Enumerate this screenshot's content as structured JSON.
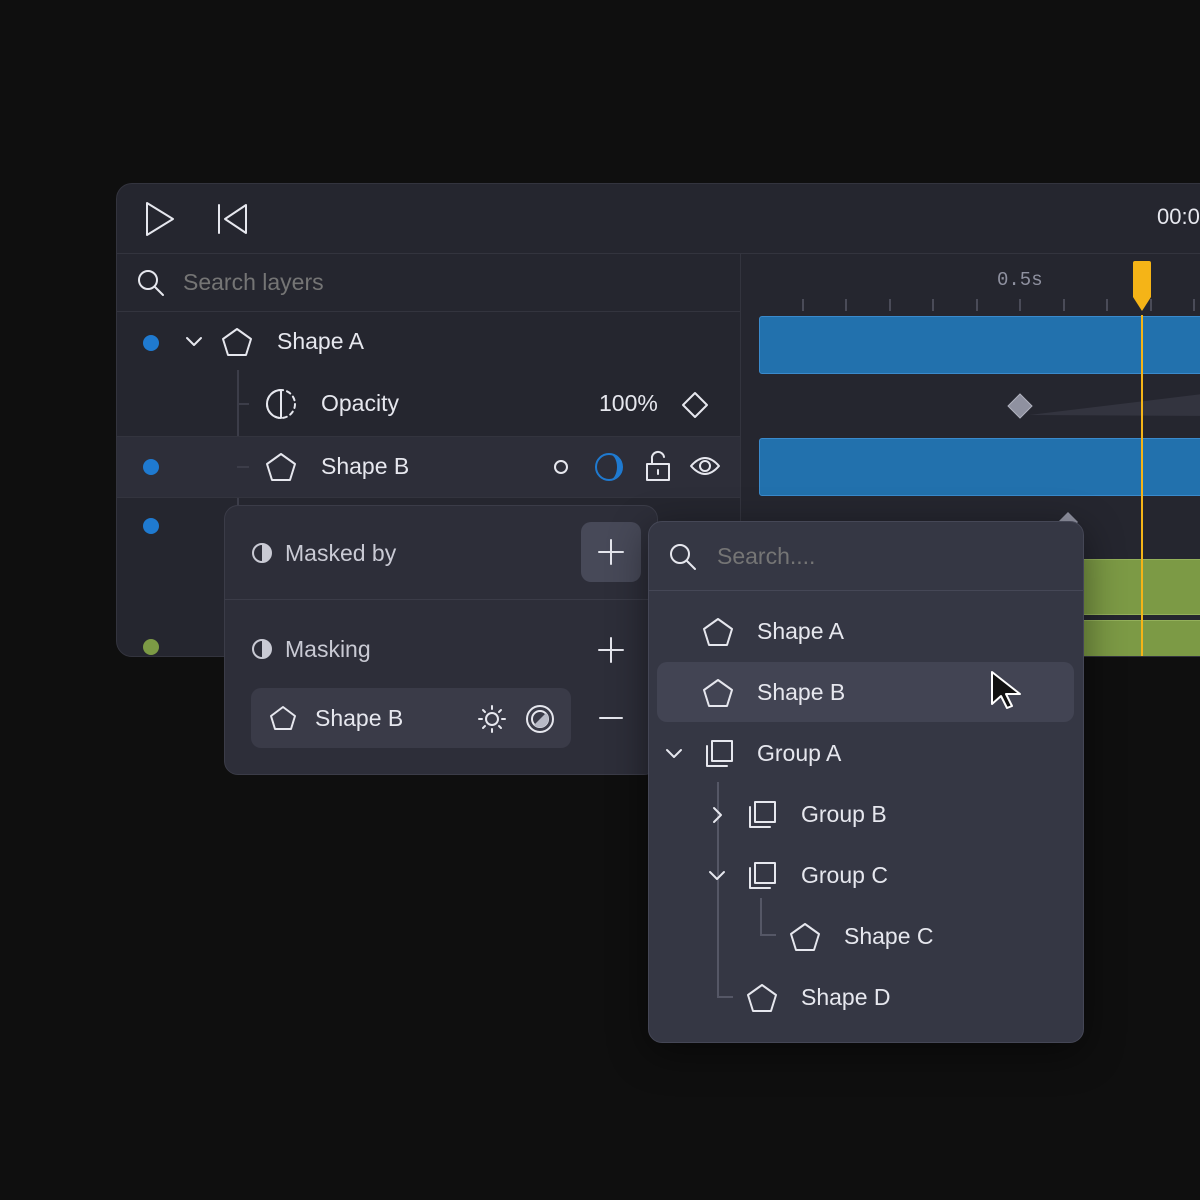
{
  "toolbar": {
    "time_display": "00:0",
    "play_icon": "play-icon",
    "rewind_icon": "skip-back-icon"
  },
  "layers": {
    "search": {
      "placeholder": "Search layers"
    },
    "items": [
      {
        "name": "Shape A",
        "icon": "pentagon-icon",
        "expanded": true,
        "color": "#1f7ad0"
      },
      {
        "name": "Opacity",
        "icon": "opacity-icon",
        "value": "100%"
      },
      {
        "name": "Shape B",
        "icon": "pentagon-icon",
        "color": "#1f7ad0",
        "selected": true
      }
    ]
  },
  "timeline": {
    "tick_label": "0.5s",
    "playhead_color": "#f5b417"
  },
  "mask_panel": {
    "masked_by_label": "Masked by",
    "masking_label": "Masking",
    "masking_items": [
      {
        "name": "Shape B",
        "icon": "pentagon-icon"
      }
    ]
  },
  "picker": {
    "search": {
      "placeholder": "Search...."
    },
    "items": [
      {
        "name": "Shape A",
        "icon": "pentagon-icon",
        "depth": 0
      },
      {
        "name": "Shape B",
        "icon": "pentagon-icon",
        "depth": 0,
        "hovered": true
      },
      {
        "name": "Group A",
        "icon": "group-icon",
        "depth": 0,
        "chevron": "down"
      },
      {
        "name": "Group B",
        "icon": "group-icon",
        "depth": 1,
        "chevron": "right"
      },
      {
        "name": "Group C",
        "icon": "group-icon",
        "depth": 1,
        "chevron": "down"
      },
      {
        "name": "Shape C",
        "icon": "pentagon-icon",
        "depth": 2
      },
      {
        "name": "Shape D",
        "icon": "pentagon-icon",
        "depth": 1
      }
    ]
  },
  "colors": {
    "accent_blue": "#1f7ad0",
    "track_green": "#7c9a45",
    "playhead": "#f5b417"
  }
}
